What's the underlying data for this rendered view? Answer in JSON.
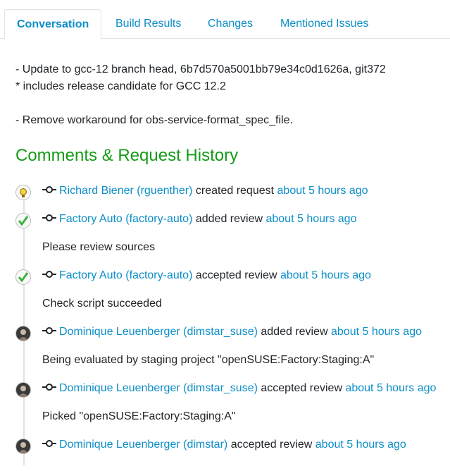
{
  "tabs": [
    {
      "label": "Conversation",
      "active": true
    },
    {
      "label": "Build Results",
      "active": false
    },
    {
      "label": "Changes",
      "active": false
    },
    {
      "label": "Mentioned Issues",
      "active": false
    }
  ],
  "description": [
    "- Update to gcc-12 branch head, 6b7d570a5001bb79e34c0d1626a, git372",
    "* includes release candidate for GCC 12.2",
    "",
    "- Remove workaround for obs-service-format_spec_file."
  ],
  "history": {
    "title": "Comments & Request History",
    "events": [
      {
        "user": "Richard Biener (rguenther)",
        "action": "created request",
        "time": "about 5 hours ago",
        "comment": "",
        "avatar": "bulb-avatar"
      },
      {
        "user": "Factory Auto (factory-auto)",
        "action": "added review",
        "time": "about 5 hours ago",
        "comment": "Please review sources",
        "avatar": "checkmark-avatar"
      },
      {
        "user": "Factory Auto (factory-auto)",
        "action": "accepted review",
        "time": "about 5 hours ago",
        "comment": "Check script succeeded",
        "avatar": "checkmark-avatar"
      },
      {
        "user": "Dominique Leuenberger (dimstar_suse)",
        "action": "added review",
        "time": "about 5 hours ago",
        "comment": "Being evaluated by staging project \"openSUSE:Factory:Staging:A\"",
        "avatar": "photo-avatar"
      },
      {
        "user": "Dominique Leuenberger (dimstar_suse)",
        "action": "accepted review",
        "time": "about 5 hours ago",
        "comment": "Picked \"openSUSE:Factory:Staging:A\"",
        "avatar": "photo-avatar"
      },
      {
        "user": "Dominique Leuenberger (dimstar)",
        "action": "accepted review",
        "time": "about 5 hours ago",
        "comment": "",
        "avatar": "photo-avatar"
      }
    ]
  },
  "colors": {
    "link": "#0c8ec8",
    "heading": "#159b15",
    "text": "#212529"
  }
}
